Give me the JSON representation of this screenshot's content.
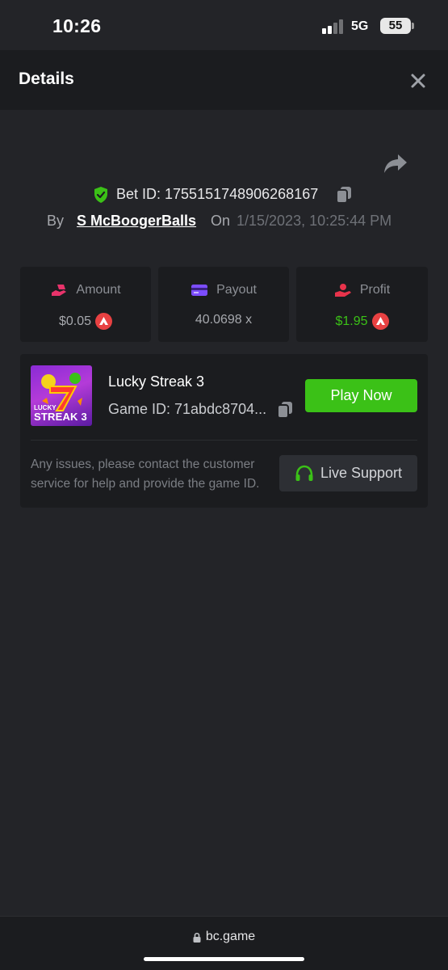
{
  "status": {
    "time": "10:26",
    "network": "5G",
    "battery": "55"
  },
  "header": {
    "title": "Details"
  },
  "bet": {
    "id_label": "Bet ID: 1755151748906268167",
    "by_label": "By",
    "username": "S McBoogerBalls",
    "on_label": "On",
    "datetime": "1/15/2023, 10:25:44 PM"
  },
  "stats": {
    "amount": {
      "label": "Amount",
      "value": "$0.05",
      "icon": "money-hand-icon",
      "color": "#e8336b"
    },
    "payout": {
      "label": "Payout",
      "value": "40.0698 x",
      "icon": "card-icon",
      "color": "#7c4dff"
    },
    "profit": {
      "label": "Profit",
      "value": "$1.95",
      "icon": "profit-hand-icon",
      "color": "#e8334b",
      "value_color": "#3bc117"
    }
  },
  "game": {
    "thumb_line1": "LUCKY",
    "thumb_line2": "STREAK 3",
    "name": "Lucky Streak 3",
    "id_label": "Game ID: 71abdc8704...",
    "play_label": "Play Now",
    "support_text": "Any issues, please contact the customer service for help and provide the game ID.",
    "support_label": "Live Support"
  },
  "browser": {
    "url": "bc.game"
  },
  "colors": {
    "accent_green": "#3bc117",
    "avax_red": "#e84142",
    "shield_green": "#3bc117"
  }
}
